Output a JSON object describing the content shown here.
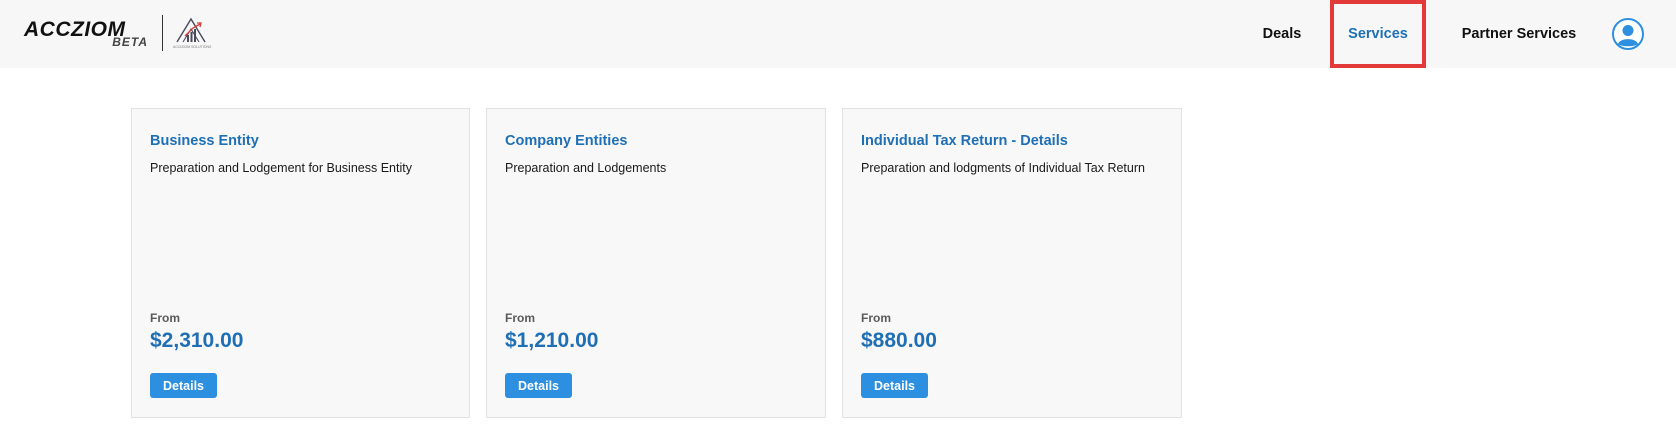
{
  "brand": {
    "name": "ACCZIOM",
    "tag": "BETA",
    "partner_logo_caption": "ACCIZIOM SOLUTIONS"
  },
  "nav": {
    "items": [
      {
        "label": "Deals",
        "active": false
      },
      {
        "label": "Services",
        "active": true
      },
      {
        "label": "Partner Services",
        "active": false
      }
    ]
  },
  "avatar_icon": "user-avatar-icon",
  "colors": {
    "accent": "#1f6fb5",
    "button": "#2d8fe0",
    "highlight": "#e23a3a",
    "topbar_bg": "#f7f7f7",
    "card_bg": "#f8f8f8"
  },
  "services": [
    {
      "title": "Business Entity",
      "description": "Preparation and Lodgement for Business Entity",
      "from_label": "From",
      "price": "$2,310.00",
      "button_label": "Details"
    },
    {
      "title": "Company Entities",
      "description": "Preparation and Lodgements",
      "from_label": "From",
      "price": "$1,210.00",
      "button_label": "Details"
    },
    {
      "title": "Individual Tax Return - Details",
      "description": "Preparation and lodgments of Individual Tax Return",
      "from_label": "From",
      "price": "$880.00",
      "button_label": "Details"
    }
  ]
}
